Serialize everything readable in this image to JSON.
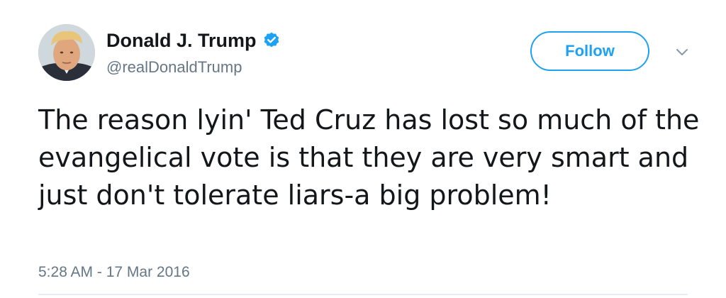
{
  "tweet": {
    "author": {
      "display_name": "Donald J. Trump",
      "handle": "@realDonaldTrump",
      "verified": true,
      "avatar_icon": "profile-photo-icon"
    },
    "follow_label": "Follow",
    "menu_icon": "chevron-down-icon",
    "text": "The reason lyin' Ted Cruz has lost so much of the evangelical vote is that they are very smart and just don't tolerate liars-a big problem!",
    "timestamp": "5:28 AM - 17 Mar 2016"
  },
  "colors": {
    "accent": "#1da1f2",
    "text": "#14171a",
    "secondary_text": "#657786",
    "divider": "#e6ecf0",
    "background": "#ffffff"
  }
}
